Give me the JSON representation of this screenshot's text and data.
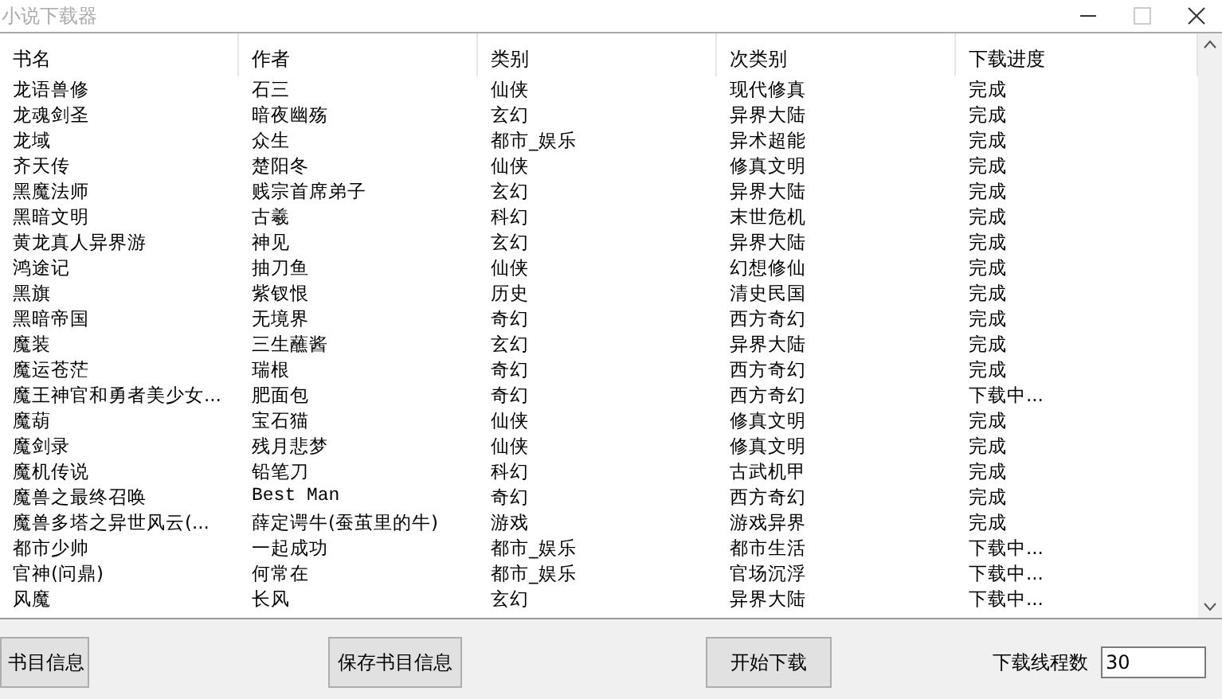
{
  "window": {
    "title": "小说下载器"
  },
  "table": {
    "columns": [
      "书名",
      "作者",
      "类别",
      "次类别",
      "下载进度"
    ],
    "rows": [
      [
        "龙语兽修",
        "石三",
        "仙侠",
        "现代修真",
        "完成"
      ],
      [
        "龙魂剑圣",
        "暗夜幽殇",
        "玄幻",
        "异界大陆",
        "完成"
      ],
      [
        "龙域",
        "众生",
        "都市_娱乐",
        "异术超能",
        "完成"
      ],
      [
        "齐天传",
        "楚阳冬",
        "仙侠",
        "修真文明",
        "完成"
      ],
      [
        "黑魔法师",
        "贱宗首席弟子",
        "玄幻",
        "异界大陆",
        "完成"
      ],
      [
        "黑暗文明",
        "古羲",
        "科幻",
        "末世危机",
        "完成"
      ],
      [
        "黄龙真人异界游",
        "神见",
        "玄幻",
        "异界大陆",
        "完成"
      ],
      [
        "鸿途记",
        "抽刀鱼",
        "仙侠",
        "幻想修仙",
        "完成"
      ],
      [
        "黑旗",
        "紫钗恨",
        "历史",
        "清史民国",
        "完成"
      ],
      [
        "黑暗帝国",
        "无境界",
        "奇幻",
        "西方奇幻",
        "完成"
      ],
      [
        "魔装",
        "三生蘸酱",
        "玄幻",
        "异界大陆",
        "完成"
      ],
      [
        "魔运苍茫",
        "瑞根",
        "奇幻",
        "西方奇幻",
        "完成"
      ],
      [
        "魔王神官和勇者美少女...",
        "肥面包",
        "奇幻",
        "西方奇幻",
        "下载中..."
      ],
      [
        "魔葫",
        "宝石猫",
        "仙侠",
        "修真文明",
        "完成"
      ],
      [
        "魔剑录",
        "残月悲梦",
        "仙侠",
        "修真文明",
        "完成"
      ],
      [
        "魔机传说",
        "铅笔刀",
        "科幻",
        "古武机甲",
        "完成"
      ],
      [
        "魔兽之最终召唤",
        "Best Man",
        "奇幻",
        "西方奇幻",
        "完成"
      ],
      [
        "魔兽多塔之异世风云(...",
        "薛定谔牛(蚕茧里的牛)",
        "游戏",
        "游戏异界",
        "完成"
      ],
      [
        "都市少帅",
        "一起成功",
        "都市_娱乐",
        "都市生活",
        "下载中..."
      ],
      [
        "官神(问鼎)",
        "何常在",
        "都市_娱乐",
        "官场沉浮",
        "下载中..."
      ],
      [
        "风魔",
        "长风",
        "玄幻",
        "异界大陆",
        "下载中..."
      ]
    ]
  },
  "buttons": [
    "书目信息",
    "保存书目信息",
    "开始下载"
  ],
  "threads": {
    "label": "下载线程数",
    "value": "30"
  }
}
